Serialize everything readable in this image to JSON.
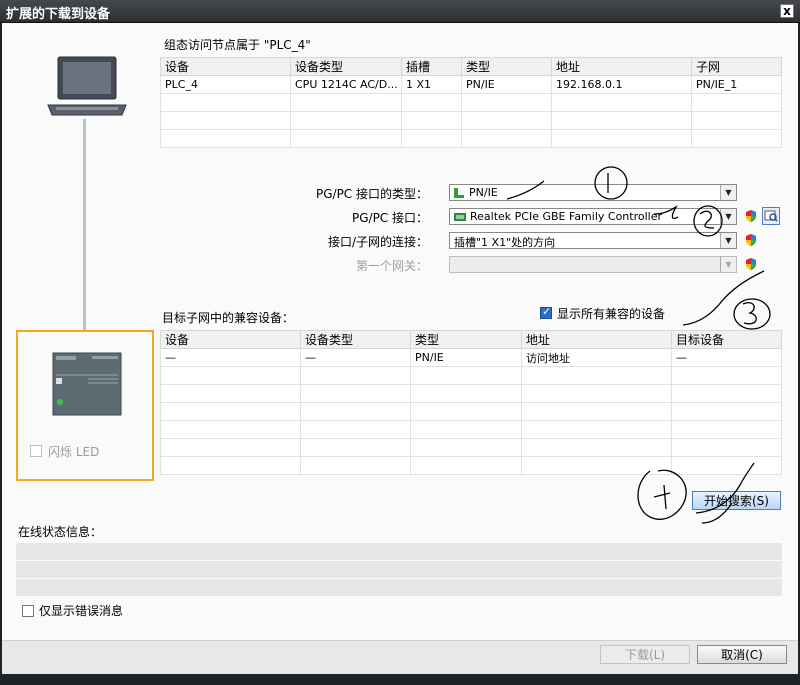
{
  "window": {
    "title": "扩展的下载到设备",
    "close_glyph": "x"
  },
  "config_section": {
    "heading": "组态访问节点属于 \"PLC_4\"",
    "columns": [
      "设备",
      "设备类型",
      "插槽",
      "类型",
      "地址",
      "子网"
    ],
    "rows": [
      [
        "PLC_4",
        "CPU 1214C AC/D...",
        "1 X1",
        "PN/IE",
        "192.168.0.1",
        "PN/IE_1"
      ]
    ]
  },
  "interface_settings": {
    "type_label": "PG/PC 接口的类型：",
    "type_value": "PN/IE",
    "interface_label": "PG/PC 接口：",
    "interface_value": "Realtek PCIe GBE Family Controller",
    "connection_label": "接口/子网的连接：",
    "connection_value": "插槽\"1 X1\"处的方向",
    "gateway_label": "第一个网关："
  },
  "target_section": {
    "heading": "目标子网中的兼容设备：",
    "show_all_label": "显示所有兼容的设备",
    "show_all_checked": true,
    "columns": [
      "设备",
      "设备类型",
      "类型",
      "地址",
      "目标设备"
    ],
    "rows": [
      [
        "—",
        "—",
        "PN/IE",
        "访问地址",
        "—"
      ]
    ]
  },
  "device_panel": {
    "flash_led_label": "闪烁 LED",
    "highlight_color": "#f5a623"
  },
  "search_button": {
    "label": "开始搜索(S)"
  },
  "status_section": {
    "heading": "在线状态信息：",
    "errors_only_label": "仅显示错误消息"
  },
  "footer": {
    "load_label": "下载(L)",
    "cancel_label": "取消(C)"
  },
  "annotations": {
    "marks": [
      "1",
      "2",
      "3",
      "4"
    ],
    "ink_color": "#000000"
  }
}
